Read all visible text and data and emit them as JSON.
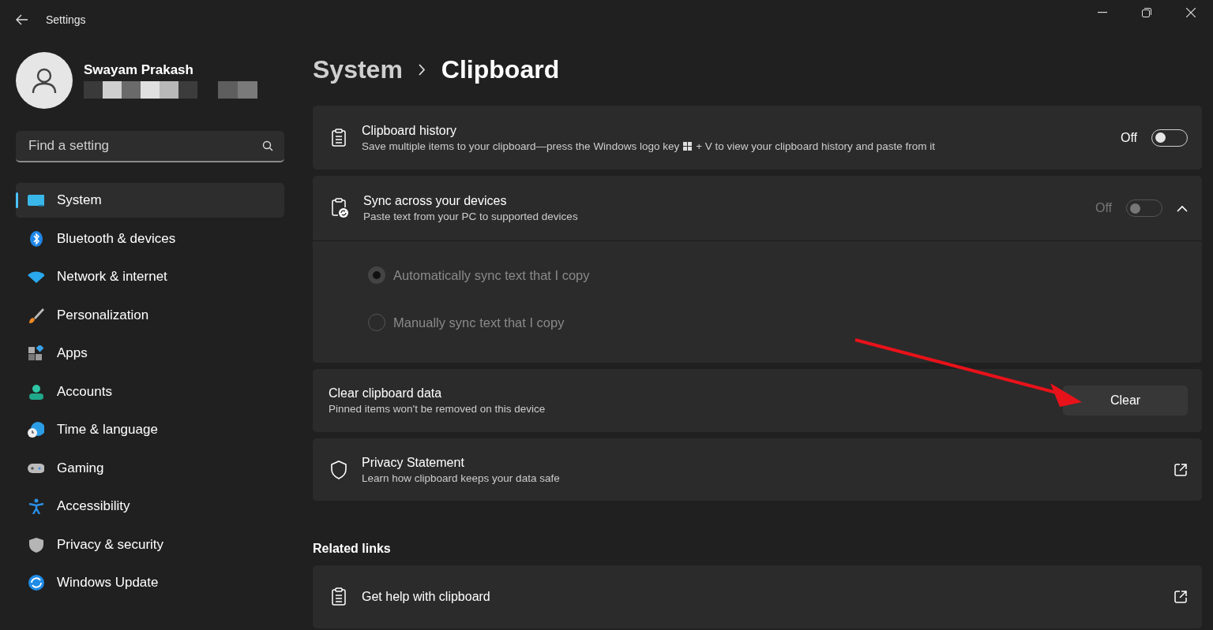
{
  "window": {
    "title": "Settings"
  },
  "user": {
    "name": "Swayam Prakash"
  },
  "search": {
    "placeholder": "Find a setting"
  },
  "sidebar": {
    "items": [
      {
        "label": "System",
        "selected": true
      },
      {
        "label": "Bluetooth & devices",
        "selected": false
      },
      {
        "label": "Network & internet",
        "selected": false
      },
      {
        "label": "Personalization",
        "selected": false
      },
      {
        "label": "Apps",
        "selected": false
      },
      {
        "label": "Accounts",
        "selected": false
      },
      {
        "label": "Time & language",
        "selected": false
      },
      {
        "label": "Gaming",
        "selected": false
      },
      {
        "label": "Accessibility",
        "selected": false
      },
      {
        "label": "Privacy & security",
        "selected": false
      },
      {
        "label": "Windows Update",
        "selected": false
      }
    ]
  },
  "breadcrumb": {
    "parent": "System",
    "current": "Clipboard"
  },
  "settings": [
    {
      "kind": "toggle",
      "title": "Clipboard history",
      "description": "Save multiple items to your clipboard—press the Windows logo key",
      "description_after": "+ V to view your clipboard history and paste from it",
      "state_label": "Off",
      "on": false,
      "disabled": false
    },
    {
      "kind": "expander",
      "title": "Sync across your devices",
      "description": "Paste text from your PC to supported devices",
      "state_label": "Off",
      "on": false,
      "disabled": true,
      "expanded": true,
      "options": [
        {
          "label": "Automatically sync text that I copy",
          "selected": true,
          "disabled": true
        },
        {
          "label": "Manually sync text that I copy",
          "selected": false,
          "disabled": true
        }
      ]
    },
    {
      "kind": "button",
      "title": "Clear clipboard data",
      "description": "Pinned items won't be removed on this device",
      "button": "Clear"
    },
    {
      "kind": "link",
      "title": "Privacy Statement",
      "description": "Learn how clipboard keeps your data safe"
    }
  ],
  "related_links": {
    "heading": "Related links",
    "items": [
      {
        "title": "Get help with clipboard"
      }
    ]
  }
}
